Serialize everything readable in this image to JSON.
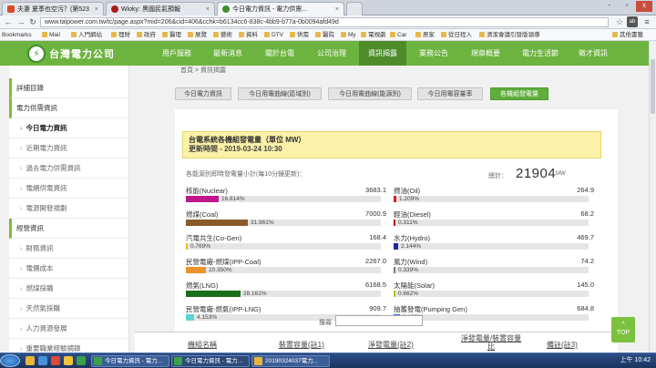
{
  "browser": {
    "tabs": [
      {
        "title": "夫妻 夏季也空污？(第523"
      },
      {
        "title": "Wioky: 黑國民氣預報"
      },
      {
        "title": "今日電力資訊 - 電力供需..."
      }
    ],
    "window_controls": [
      "-",
      "▫",
      "x"
    ],
    "url": "www.taipower.com.tw/tc/page.aspx?mid=206&cid=406&cchk=b6134cc6-838c-4bb9-b77a-0b0094afd49d",
    "bookmarks": [
      "Bookmarks",
      "Mail",
      "入門網站",
      "理財",
      "政府",
      "醫理",
      "展覽",
      "藝術",
      "資料",
      "DTV",
      "供需",
      "醫院",
      "My",
      "電視劇",
      "Car",
      "居家",
      "從日程入",
      "清潔會議引發版領導"
    ],
    "other_bookmarks": "其他書籤"
  },
  "site": {
    "logo_text": "台灣電力公司",
    "nav": [
      "用戶服務",
      "最新消息",
      "關於台電",
      "公司治理",
      "資訊揭露",
      "業務公告",
      "規章概要",
      "電力生活節",
      "徵才資訊"
    ],
    "active_nav": "資訊揭露"
  },
  "sidebar": {
    "heading": "",
    "items": [
      {
        "label": "詳細目錄",
        "type": "main"
      },
      {
        "label": "電力供需資訊",
        "type": "main"
      },
      {
        "label": "今日電力資訊",
        "type": "sub",
        "current": true
      },
      {
        "label": "近期電力資訊",
        "type": "sub"
      },
      {
        "label": "過去電力供需資訊",
        "type": "sub"
      },
      {
        "label": "電網供電資訊",
        "type": "sub"
      },
      {
        "label": "電源開發規劃",
        "type": "sub"
      },
      {
        "label": "經營資訊",
        "type": "main"
      },
      {
        "label": "財務資訊",
        "type": "sub"
      },
      {
        "label": "電價成本",
        "type": "sub"
      },
      {
        "label": "燃煤採購",
        "type": "sub"
      },
      {
        "label": "天然氣採購",
        "type": "sub"
      },
      {
        "label": "人力資源發展",
        "type": "sub"
      },
      {
        "label": "重要職業經驗摘錄",
        "type": "sub"
      }
    ]
  },
  "page": {
    "breadcrumb": "首頁 > 資訊揭露",
    "tabs": [
      "今日電力資訊",
      "今日用電曲線(區域別)",
      "今日用電曲線(能源別)",
      "今日用電容量率",
      "各機組發電量"
    ],
    "active_tab": "各機組發電量",
    "title": "台電系統各機組發電量（單位 MW）",
    "updated": "更新時間 - 2019-03-24 10:30",
    "subtitle": "各能源別即時發電量小計(每10分鐘更新)：",
    "total_label": "總計：",
    "total_value": "21904",
    "total_unit": "MW",
    "sources_left": [
      {
        "name": "核能(Nuclear)",
        "value": "3683.1",
        "pct": "16.814%",
        "frac": 0.16814,
        "color": "#c0188a"
      },
      {
        "name": "燃煤(Coal)",
        "value": "7000.9",
        "pct": "31.961%",
        "frac": 0.31961,
        "color": "#8b5a2b"
      },
      {
        "name": "汽電共生(Co-Gen)",
        "value": "168.4",
        "pct": "0.769%",
        "frac": 0.00769,
        "color": "#e6c229"
      },
      {
        "name": "民營電廠-燃煤(IPP-Coal)",
        "value": "2267.0",
        "pct": "10.350%",
        "frac": 0.1035,
        "color": "#f0922b"
      },
      {
        "name": "燃氣(LNG)",
        "value": "6168.5",
        "pct": "28.161%",
        "frac": 0.28161,
        "color": "#1b6e1b"
      },
      {
        "name": "民營電廠-燃氣(IPP-LNG)",
        "value": "909.7",
        "pct": "4.153%",
        "frac": 0.04153,
        "color": "#5ad4d4"
      }
    ],
    "sources_right": [
      {
        "name": "燃油(Oil)",
        "value": "264.9",
        "pct": "1.209%",
        "frac": 0.01209,
        "color": "#d82020"
      },
      {
        "name": "輕油(Diesel)",
        "value": "68.2",
        "pct": "0.311%",
        "frac": 0.00311,
        "color": "#b01818"
      },
      {
        "name": "水力(Hydro)",
        "value": "469.7",
        "pct": "2.144%",
        "frac": 0.02144,
        "color": "#1a2a9a"
      },
      {
        "name": "風力(Wind)",
        "value": "74.2",
        "pct": "0.339%",
        "frac": 0.00339,
        "color": "#7a7a7a"
      },
      {
        "name": "太陽能(Solar)",
        "value": "145.0",
        "pct": "0.662%",
        "frac": 0.00662,
        "color": "#a0c820"
      },
      {
        "name": "抽蓄發電(Pumping Gen)",
        "value": "684.8",
        "pct": "3.126%",
        "frac": 0.03126,
        "color": "#3070d0"
      }
    ],
    "search_label": "搜尋",
    "table_headers": [
      "機組名稱",
      "裝置容量(註1)",
      "淨發電量(註2)",
      "淨發電量/裝置容量比",
      "備註(註3)"
    ]
  },
  "to_top": {
    "arrow": "^",
    "label": "TOP"
  },
  "taskbar": {
    "tasks": [
      "今日電力資訊 - 電力...",
      "今日電力資訊 - 電力...",
      "20190324037電力..."
    ],
    "tray": "上午 10:42"
  }
}
